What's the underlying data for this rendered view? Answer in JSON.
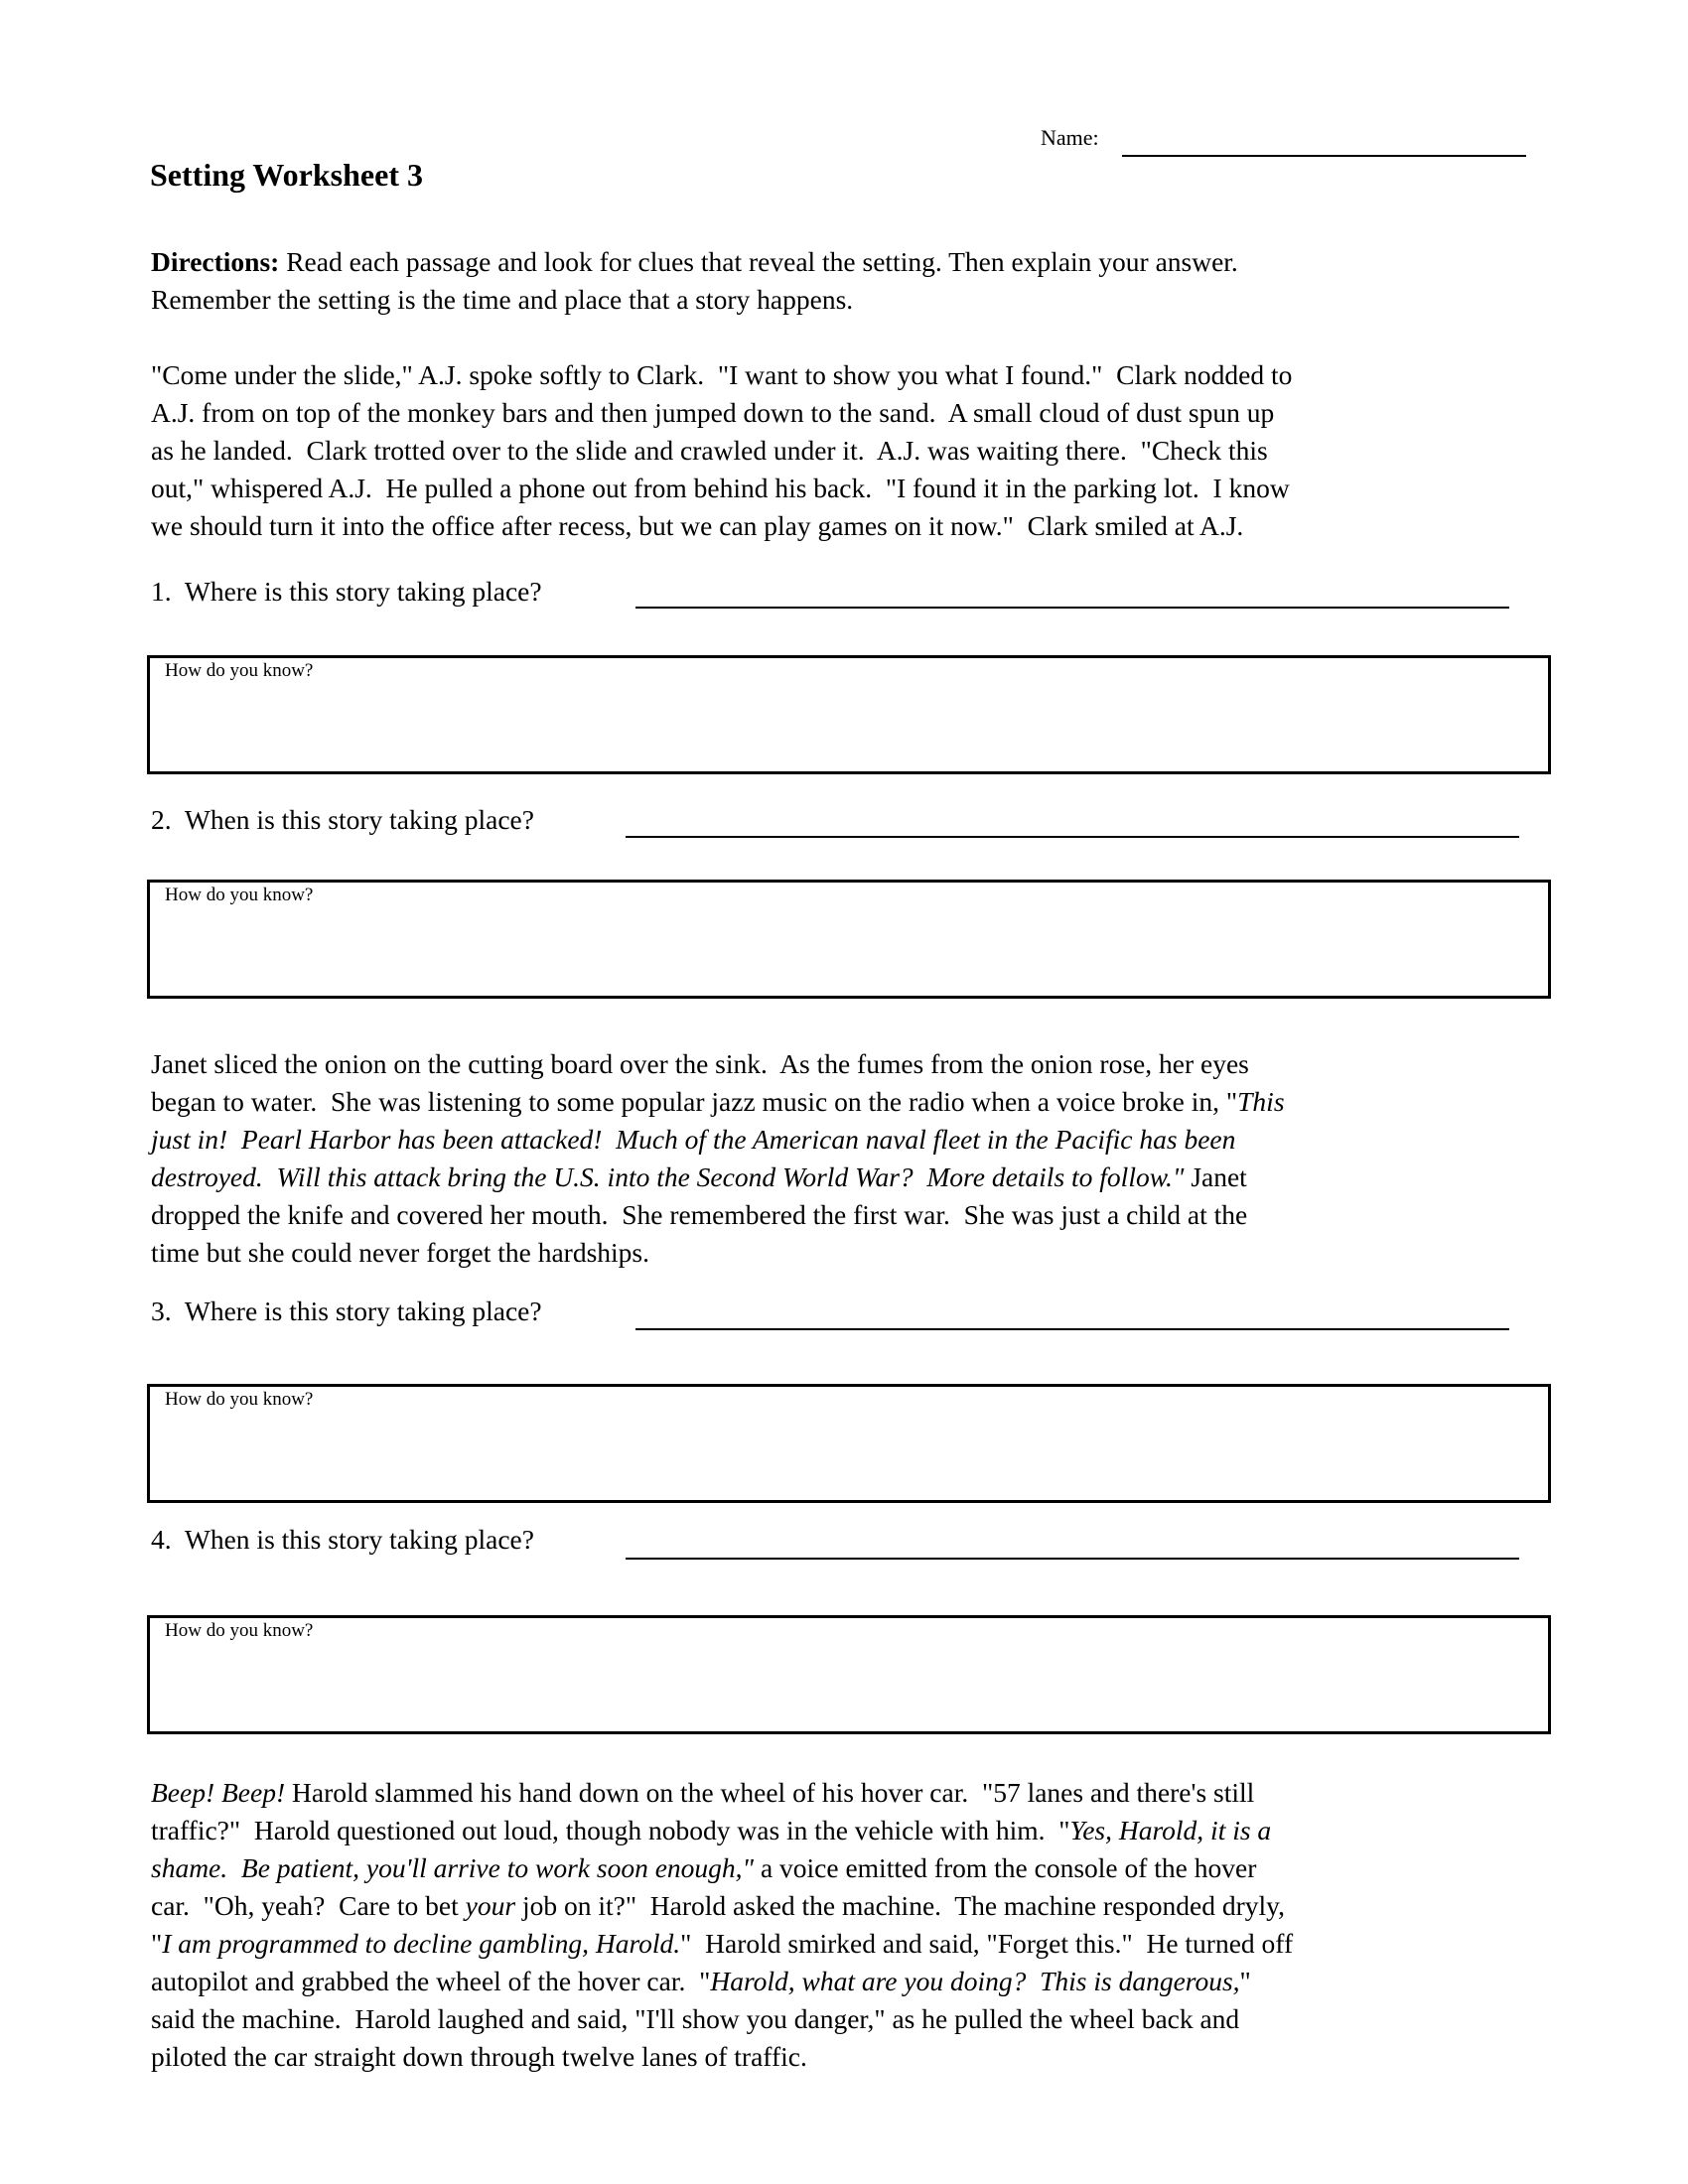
{
  "header": {
    "name_label": "Name:",
    "title": "Setting Worksheet 3"
  },
  "directions": {
    "label": "Directions:",
    "lines": [
      " Read each passage and look for clues that reveal the setting.  Then explain your answer.",
      "Remember the setting is the time and place that a story happens."
    ]
  },
  "passages": [
    {
      "lines": [
        [
          {
            "t": "\"Come under the slide,\" A.J. spoke softly to Clark.  \"I want to show you what I found.\"  Clark nodded to",
            "i": false
          }
        ],
        [
          {
            "t": "A.J. from on top of the monkey bars and then jumped down to the sand.  A small cloud of dust spun up",
            "i": false
          }
        ],
        [
          {
            "t": "as he landed.  Clark trotted over to the slide and crawled under it.  A.J. was waiting there.  \"Check this",
            "i": false
          }
        ],
        [
          {
            "t": "out,\" whispered A.J.  He pulled a phone out from behind his back.  \"I found it in the parking lot.  I know",
            "i": false
          }
        ],
        [
          {
            "t": "we should turn it into the office after recess, but we can play games on it now.\"  Clark smiled at A.J.",
            "i": false
          }
        ]
      ]
    },
    {
      "lines": [
        [
          {
            "t": "Janet sliced the onion on the cutting board over the sink.  As the fumes from the onion rose, her eyes",
            "i": false
          }
        ],
        [
          {
            "t": "began to water.  She was listening to some popular jazz music on the radio when a voice broke in, \"",
            "i": false
          },
          {
            "t": "This",
            "i": true
          }
        ],
        [
          {
            "t": "just in!  Pearl Harbor has been attacked!  Much of the American naval fleet in the Pacific has been",
            "i": true
          }
        ],
        [
          {
            "t": "destroyed.  Will this attack bring the U.S. into the Second World War?  More details to follow.\"",
            "i": true
          },
          {
            "t": " Janet",
            "i": false
          }
        ],
        [
          {
            "t": "dropped the knife and covered her mouth.  She remembered the first war.  She was just a child at the",
            "i": false
          }
        ],
        [
          {
            "t": "time but she could never forget the hardships.",
            "i": false
          }
        ]
      ]
    },
    {
      "lines": [
        [
          {
            "t": "Beep! Beep!",
            "i": true
          },
          {
            "t": " Harold slammed his hand down on the wheel of his hover car.  \"57 lanes and there's still",
            "i": false
          }
        ],
        [
          {
            "t": "traffic?\"  Harold questioned out loud, though nobody was in the vehicle with him.  \"",
            "i": false
          },
          {
            "t": "Yes, Harold, it is a",
            "i": true
          }
        ],
        [
          {
            "t": "shame.  Be patient, you'll arrive to work soon enough,\"",
            "i": true
          },
          {
            "t": " a voice emitted from the console of the hover",
            "i": false
          }
        ],
        [
          {
            "t": "car.  \"Oh, yeah?  Care to bet ",
            "i": false
          },
          {
            "t": "your",
            "i": true
          },
          {
            "t": " job on it?\"  Harold asked the machine.  The machine responded dryly,",
            "i": false
          }
        ],
        [
          {
            "t": "\"",
            "i": false
          },
          {
            "t": "I am programmed to decline gambling, Harold.",
            "i": true
          },
          {
            "t": "\"  Harold smirked and said, \"Forget this.\"  He turned off",
            "i": false
          }
        ],
        [
          {
            "t": "autopilot and grabbed the wheel of the hover car.  \"",
            "i": false
          },
          {
            "t": "Harold, what are you doing?  This is dangerous,",
            "i": true
          },
          {
            "t": "\"",
            "i": false
          }
        ],
        [
          {
            "t": "said the machine.  Harold laughed and said, \"I'll show you danger,\" as he pulled the wheel back and",
            "i": false
          }
        ],
        [
          {
            "t": "piloted the car straight down through twelve lanes of traffic.",
            "i": false
          }
        ]
      ]
    }
  ],
  "questions": [
    {
      "number": "1.",
      "text": "Where is this story taking place?",
      "answer": "",
      "box_label": "How do you know?",
      "box_value": ""
    },
    {
      "number": "2.",
      "text": "When is this story taking place?",
      "answer": "",
      "box_label": "How do you know?",
      "box_value": ""
    },
    {
      "number": "3.",
      "text": "Where is this story taking place?",
      "answer": "",
      "box_label": "How do you know?",
      "box_value": ""
    },
    {
      "number": "4.",
      "text": "When is this story taking place?",
      "answer": "",
      "box_label": "How do you know?",
      "box_value": ""
    }
  ]
}
